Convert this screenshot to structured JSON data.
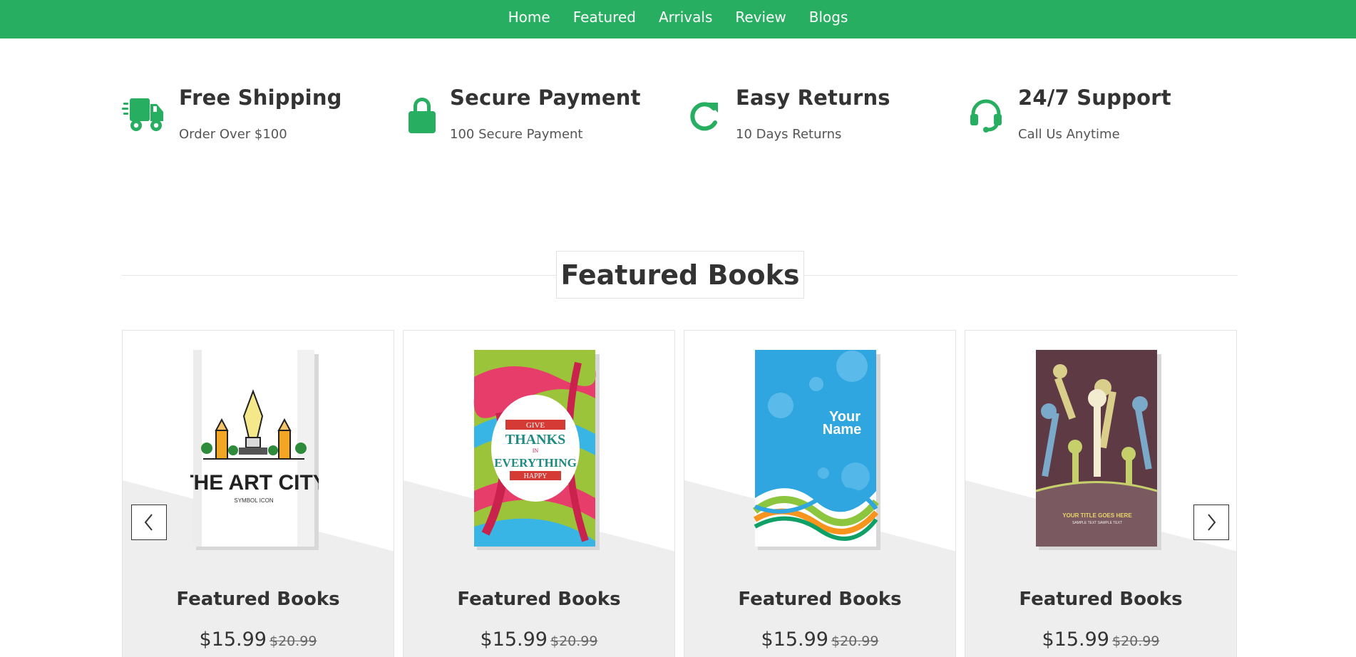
{
  "nav": {
    "items": [
      {
        "label": "Home"
      },
      {
        "label": "Featured"
      },
      {
        "label": "Arrivals"
      },
      {
        "label": "Review"
      },
      {
        "label": "Blogs"
      }
    ]
  },
  "features": [
    {
      "icon": "truck-icon",
      "title": "Free Shipping",
      "subtitle": "Order Over $100"
    },
    {
      "icon": "lock-icon",
      "title": "Secure Payment",
      "subtitle": "100 Secure Payment"
    },
    {
      "icon": "redo-icon",
      "title": "Easy Returns",
      "subtitle": "10 Days Returns"
    },
    {
      "icon": "headset-icon",
      "title": "24/7 Support",
      "subtitle": "Call Us Anytime"
    }
  ],
  "section": {
    "heading": "Featured Books"
  },
  "books": [
    {
      "title": "Featured Books",
      "price": "$15.99",
      "old_price": "$20.99",
      "cover_text": [
        "THE ART CITY",
        "SYMBOL ICON"
      ]
    },
    {
      "title": "Featured Books",
      "price": "$15.99",
      "old_price": "$20.99",
      "cover_text": [
        "GIVE",
        "THANKS",
        "IN",
        "EVERYTHING",
        "HAPPY"
      ]
    },
    {
      "title": "Featured Books",
      "price": "$15.99",
      "old_price": "$20.99",
      "cover_text": [
        "Your",
        "Name"
      ]
    },
    {
      "title": "Featured Books",
      "price": "$15.99",
      "old_price": "$20.99",
      "cover_text": [
        "YOUR TITLE GOES HERE",
        "SAMPLE TEXT SAMPLE TEXT"
      ]
    }
  ],
  "colors": {
    "brand": "#27ae60",
    "text": "#333333",
    "card_wedge": "#eeeeee"
  },
  "controls": {
    "prev_icon": "chevron-left-icon",
    "next_icon": "chevron-right-icon"
  }
}
